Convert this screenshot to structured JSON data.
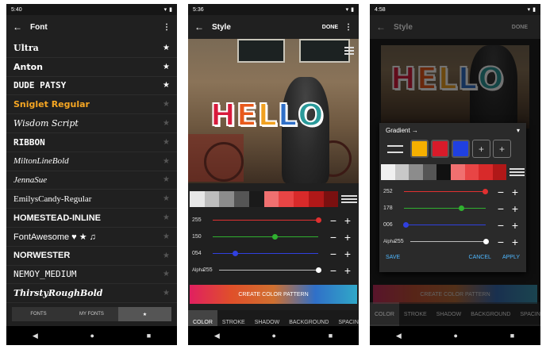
{
  "screen1": {
    "status_time": "5:40",
    "title": "Font",
    "fonts": [
      {
        "name": "Ultra",
        "starred": true,
        "color": "#ffffff",
        "family": "\"DejaVu Serif\", serif",
        "weight": "900",
        "style": "normal"
      },
      {
        "name": "Anton",
        "starred": true,
        "color": "#ffffff",
        "family": "\"DejaVu Sans\", sans-serif",
        "weight": "bold",
        "style": "normal"
      },
      {
        "name": "DUDE PATSY",
        "starred": true,
        "color": "#ffffff",
        "family": "\"DejaVu Sans Mono\", monospace",
        "weight": "bold",
        "style": "normal"
      },
      {
        "name": "Sniglet Regular",
        "starred": false,
        "color": "#f5a623",
        "family": "\"DejaVu Sans\", sans-serif",
        "weight": "bold",
        "style": "normal"
      },
      {
        "name": "Wisdom Script",
        "starred": false,
        "color": "#ffffff",
        "family": "\"DejaVu Serif\", serif",
        "weight": "normal",
        "style": "italic"
      },
      {
        "name": "RIBBON",
        "starred": false,
        "color": "#ffffff",
        "family": "\"DejaVu Sans Mono\", monospace",
        "weight": "bold",
        "style": "normal"
      },
      {
        "name": "MiltonLineBold",
        "starred": false,
        "color": "#ffffff",
        "family": "\"Liberation Serif\", serif",
        "weight": "normal",
        "style": "italic"
      },
      {
        "name": "JennaSue",
        "starred": false,
        "color": "#ffffff",
        "family": "\"Liberation Serif\", serif",
        "weight": "normal",
        "style": "italic"
      },
      {
        "name": "EmilysCandy-Regular",
        "starred": false,
        "color": "#ffffff",
        "family": "\"Liberation Serif\", serif",
        "weight": "normal",
        "style": "normal"
      },
      {
        "name": "HOMESTEAD-INLINE",
        "starred": false,
        "color": "#ffffff",
        "family": "\"Liberation Sans\", sans-serif",
        "weight": "bold",
        "style": "normal"
      },
      {
        "name": "FontAwesome ♥ ★ ♫",
        "starred": false,
        "color": "#ffffff",
        "family": "\"Liberation Sans\", sans-serif",
        "weight": "normal",
        "style": "normal"
      },
      {
        "name": "NORWESTER",
        "starred": false,
        "color": "#ffffff",
        "family": "\"Liberation Sans\", sans-serif",
        "weight": "bold",
        "style": "normal"
      },
      {
        "name": "NEMOY_MEDIUM",
        "starred": false,
        "color": "#ffffff",
        "family": "\"DejaVu Sans Mono\", monospace",
        "weight": "normal",
        "style": "normal"
      },
      {
        "name": "ThirstyRoughBold",
        "starred": false,
        "color": "#ffffff",
        "family": "\"DejaVu Serif\", serif",
        "weight": "bold",
        "style": "italic"
      }
    ],
    "tabs": [
      "FONTS",
      "MY FONTS",
      "★"
    ]
  },
  "screen2": {
    "status_time": "5:36",
    "title": "Style",
    "done_label": "DONE",
    "hello_letters": [
      {
        "ch": "H",
        "color": "#d81b3c"
      },
      {
        "ch": "E",
        "color": "#e85a1c"
      },
      {
        "ch": "L",
        "color": "#f0a020"
      },
      {
        "ch": "L",
        "color": "#3070c8"
      },
      {
        "ch": "O",
        "color": "#2a9a9a"
      }
    ],
    "swatches": [
      "#e6e6e6",
      "#bdbdbd",
      "#8c8c8c",
      "#555555",
      "#1a1a1a",
      "#f07070",
      "#e84545",
      "#d82a2a",
      "#b01818",
      "#7a1010"
    ],
    "sliders": [
      {
        "label": "255",
        "value": 255,
        "color": "#e03030"
      },
      {
        "label": "150",
        "value": 150,
        "color": "#30b030"
      },
      {
        "label": "054",
        "value": 54,
        "color": "#3040e0"
      }
    ],
    "alpha_label": "Alpha",
    "alpha_value": "255",
    "alpha_num": 255,
    "cta": "CREATE COLOR PATTERN",
    "tabs": [
      "COLOR",
      "STROKE",
      "SHADOW",
      "BACKGROUND",
      "SPACING"
    ]
  },
  "screen3": {
    "status_time": "4:58",
    "title": "Style",
    "done_label": "DONE",
    "gradient_label": "Gradient →",
    "presets": [
      "#f5b000",
      "#d81b2a",
      "#2040e0"
    ],
    "swatches": [
      "#f0f0f0",
      "#c8c8c8",
      "#8c8c8c",
      "#555555",
      "#111111",
      "#f07070",
      "#e84545",
      "#d82a2a",
      "#b01818"
    ],
    "sliders": [
      {
        "label": "252",
        "value": 252,
        "color": "#e03030"
      },
      {
        "label": "178",
        "value": 178,
        "color": "#30b030"
      },
      {
        "label": "006",
        "value": 6,
        "color": "#3040e0"
      }
    ],
    "alpha_label": "Alpha",
    "alpha_value": "255",
    "alpha_num": 255,
    "save": "SAVE",
    "cancel": "CANCEL",
    "apply": "APPLY",
    "cta": "CREATE COLOR PATTERN",
    "tabs": [
      "COLOR",
      "STROKE",
      "SHADOW",
      "BACKGROUND",
      "SPACING"
    ]
  }
}
